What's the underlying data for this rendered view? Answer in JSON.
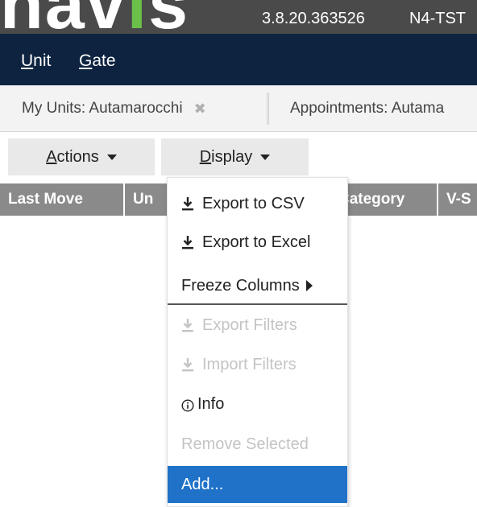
{
  "app": {
    "logo_main": "nav",
    "logo_accent": "i",
    "logo_tail": "s",
    "version": "3.8.20.363526",
    "environment": "N4-TST"
  },
  "menubar": {
    "items": [
      {
        "accel": "U",
        "rest": "nit"
      },
      {
        "accel": "G",
        "rest": "ate"
      }
    ]
  },
  "tabs": [
    {
      "label": "My Units: Autamarocchi",
      "close": "✖"
    },
    {
      "label": "Appointments: Autama"
    }
  ],
  "toolbar": {
    "actions": {
      "accel": "A",
      "rest": "ctions"
    },
    "display": {
      "accel": "D",
      "rest": "isplay"
    }
  },
  "grid": {
    "columns": [
      "Last Move",
      "Un",
      "Category",
      "V-S"
    ]
  },
  "dropdown": {
    "items": [
      {
        "label": "Export to CSV",
        "icon": "download-icon",
        "enabled": true
      },
      {
        "label": "Export to Excel",
        "icon": "download-icon",
        "enabled": true
      },
      {
        "label": "Freeze Columns",
        "icon": "submenu-arrow-icon",
        "enabled": true
      },
      {
        "label": "Export Filters",
        "icon": "download-icon",
        "enabled": false
      },
      {
        "label": "Import Filters",
        "icon": "download-icon",
        "enabled": false
      },
      {
        "label": "Info",
        "icon": "info-icon",
        "enabled": true
      },
      {
        "label": "Remove Selected",
        "enabled": false
      },
      {
        "label": "Add...",
        "enabled": true,
        "selected": true
      }
    ]
  },
  "colors": {
    "banner": "#4a4a4a",
    "logo_green": "#6cc04a",
    "menubar": "#0d2340",
    "grid_header": "#8a8a8a",
    "selection": "#1f72c8",
    "disabled_text": "#c4c4c4"
  }
}
